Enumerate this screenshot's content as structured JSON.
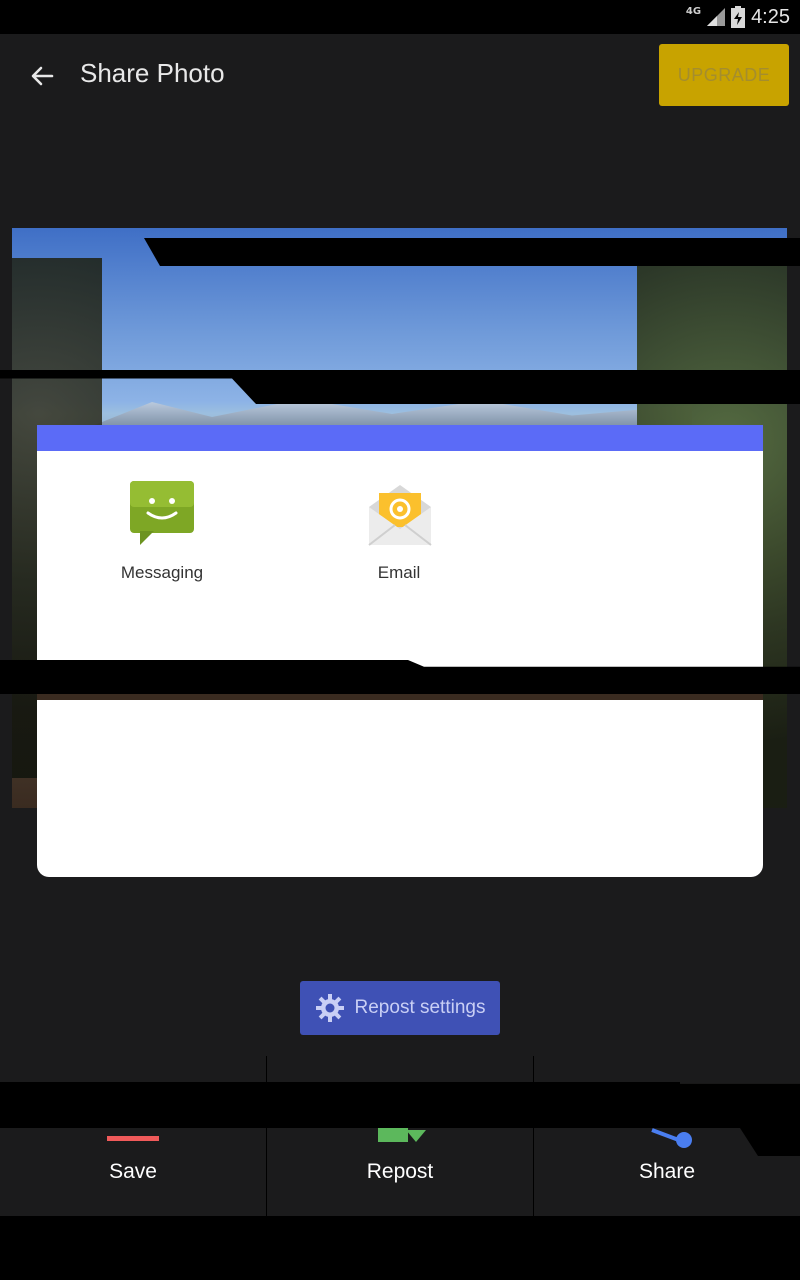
{
  "status_bar": {
    "network": "4G",
    "time": "4:25"
  },
  "app_bar": {
    "title": "Share Photo",
    "upgrade_label": "UPGRADE",
    "back_icon": "arrow-left-icon"
  },
  "share_dialog": {
    "apps": [
      {
        "label": "Messaging",
        "icon": "messaging-icon"
      },
      {
        "label": "Email",
        "icon": "email-icon"
      }
    ]
  },
  "repost_settings": {
    "label": "Repost settings",
    "icon": "gear-icon"
  },
  "bottom_nav": [
    {
      "label": "Save",
      "icon": "save-icon"
    },
    {
      "label": "Repost",
      "icon": "repost-icon"
    },
    {
      "label": "Share",
      "icon": "share-icon"
    }
  ],
  "colors": {
    "upgrade_bg": "#c8a300",
    "dialog_accent": "#5b6bf7",
    "repost_button": "#3f51b5",
    "save_accent": "#f05a5a",
    "repost_accent": "#5cb85c",
    "share_accent": "#4a7ef0"
  }
}
